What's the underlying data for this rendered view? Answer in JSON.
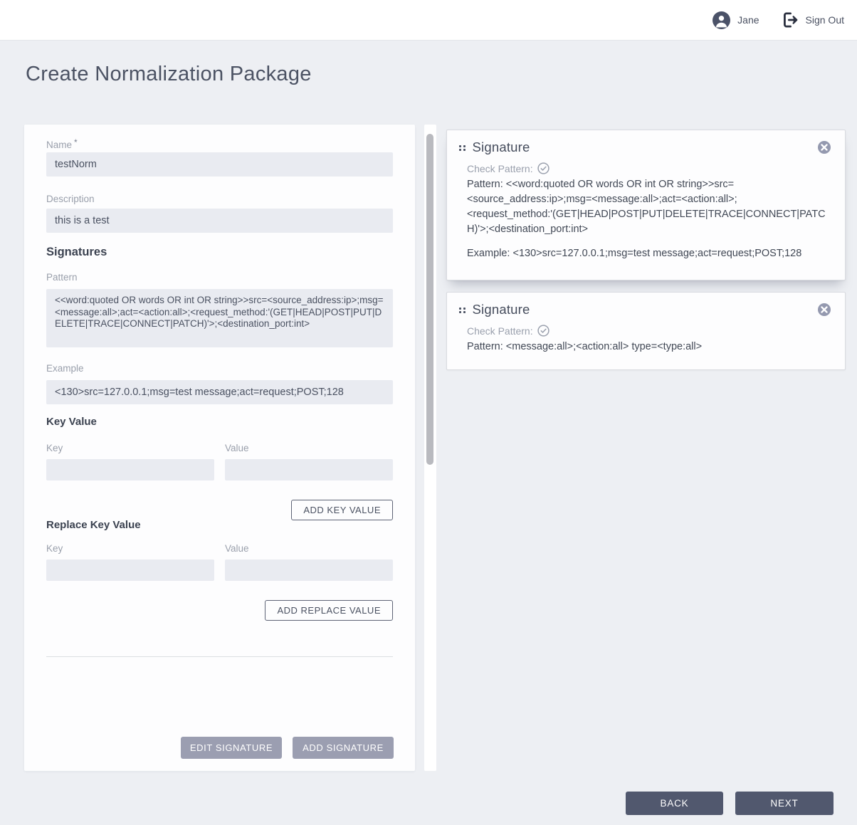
{
  "header": {
    "user_name": "Jane",
    "sign_out_label": "Sign Out",
    "user_icon": "person-circle",
    "sign_out_icon": "logout-arrow"
  },
  "page": {
    "title": "Create Normalization Package"
  },
  "form": {
    "name": {
      "label": "Name",
      "required_marker": "*",
      "value": "testNorm"
    },
    "description": {
      "label": "Description",
      "value": "this is a test"
    },
    "signatures_heading": "Signatures",
    "pattern": {
      "label": "Pattern",
      "value": "<<word:quoted OR words OR int OR string>>src=<source_address:ip>;msg=<message:all>;act=<action:all>;<request_method:'(GET|HEAD|POST|PUT|DELETE|TRACE|CONNECT|PATCH)'>;<destination_port:int>"
    },
    "example": {
      "label": "Example",
      "value": "<130>src=127.0.0.1;msg=test message;act=request;POST;128"
    },
    "key_value": {
      "heading": "Key Value",
      "key_label": "Key",
      "key_value": "",
      "value_label": "Value",
      "value_value": "",
      "add_button": "ADD KEY VALUE"
    },
    "replace_key_value": {
      "heading": "Replace Key Value",
      "key_label": "Key",
      "key_value": "",
      "value_label": "Value",
      "value_value": "",
      "add_button": "ADD REPLACE VALUE"
    },
    "edit_signature_button": "EDIT SIGNATURE",
    "add_signature_button": "ADD SIGNATURE"
  },
  "signature_cards": [
    {
      "title": "Signature",
      "drag_icon": "drag-handle-dots",
      "close_icon": "close-circle",
      "check_icon": "check-circle",
      "check_pattern_label": "Check Pattern:",
      "pattern_text": "Pattern: <<word:quoted OR words OR int OR string>>src=<source_address:ip>;msg=<message:all>;act=<action:all>;<request_method:'(GET|HEAD|POST|PUT|DELETE|TRACE|CONNECT|PATCH)'>;<destination_port:int>",
      "example_text": "Example: <130>src=127.0.0.1;msg=test message;act=request;POST;128"
    },
    {
      "title": "Signature",
      "drag_icon": "drag-handle-dots",
      "close_icon": "close-circle",
      "check_icon": "check-circle",
      "check_pattern_label": "Check Pattern:",
      "pattern_text": "Pattern: <message:all>;<action:all> type=<type:all>"
    }
  ],
  "footer": {
    "back_button": "BACK",
    "next_button": "NEXT"
  },
  "colors": {
    "page_bg": "#edeff3",
    "card_bg": "#fdfdfe",
    "input_bg": "#e9ebf1",
    "dark_button": "#51586e",
    "muted_button": "#9b9eb1",
    "text_dark": "#454c5c",
    "text_muted": "#999fab",
    "card_border": "#d9dbe0"
  }
}
